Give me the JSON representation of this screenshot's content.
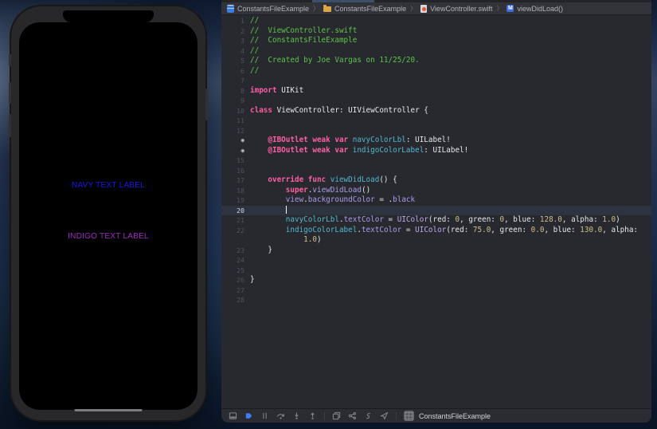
{
  "simulator": {
    "navy_label": "NAVY TEXT LABEL",
    "navy_color": "#1d16ee",
    "indigo_label": "INDIGO TEXT LABEL",
    "indigo_color": "#a428c8"
  },
  "jumpbar": {
    "separator": "〉",
    "project": "ConstantsFileExample",
    "group": "ConstantsFileExample",
    "file": "ViewController.swift",
    "method": "viewDidLoad()",
    "method_badge": "M"
  },
  "editor": {
    "colors": {
      "background": "#27292e",
      "current_line": "#2e3340",
      "comment": "#5dc34a",
      "keyword": "#fc5fa3",
      "project_symbol": "#54b8ce",
      "sdk_member": "#ab9bea",
      "sdk_class": "#c0a6f0",
      "number": "#d0bf8f",
      "plain": "#e8e8ea"
    },
    "outlet_marker": "◉",
    "lines": [
      {
        "num": "1",
        "segs": [
          [
            "cm",
            "//"
          ]
        ]
      },
      {
        "num": "2",
        "segs": [
          [
            "cm",
            "//  ViewController.swift"
          ]
        ]
      },
      {
        "num": "3",
        "segs": [
          [
            "cm",
            "//  ConstantsFileExample"
          ]
        ]
      },
      {
        "num": "4",
        "segs": [
          [
            "cm",
            "//"
          ]
        ]
      },
      {
        "num": "5",
        "segs": [
          [
            "cm",
            "//  Created by Joe Vargas on 11/25/20."
          ]
        ]
      },
      {
        "num": "6",
        "segs": [
          [
            "cm",
            "//"
          ]
        ]
      },
      {
        "num": "7",
        "segs": []
      },
      {
        "num": "8",
        "segs": [
          [
            "kw",
            "import"
          ],
          [
            "pl",
            " UIKit"
          ]
        ]
      },
      {
        "num": "9",
        "segs": []
      },
      {
        "num": "10",
        "segs": [
          [
            "kw",
            "class"
          ],
          [
            "pl",
            " ViewController: UIViewController {"
          ]
        ]
      },
      {
        "num": "11",
        "segs": []
      },
      {
        "num": "12",
        "segs": []
      },
      {
        "num": "13",
        "marker": true,
        "segs": [
          [
            "kw",
            "    @IBOutlet weak var"
          ],
          [
            "pr",
            " navyColorLbl"
          ],
          [
            "pl",
            ": UILabel!"
          ]
        ]
      },
      {
        "num": "14",
        "marker": true,
        "segs": [
          [
            "kw",
            "    @IBOutlet weak var"
          ],
          [
            "pr",
            " indigoColorLabel"
          ],
          [
            "pl",
            ": UILabel!"
          ]
        ]
      },
      {
        "num": "15",
        "segs": []
      },
      {
        "num": "16",
        "segs": []
      },
      {
        "num": "17",
        "segs": [
          [
            "pl",
            "    "
          ],
          [
            "kw",
            "override func"
          ],
          [
            "pr",
            " viewDidLoad"
          ],
          [
            "pl",
            "() {"
          ]
        ]
      },
      {
        "num": "18",
        "segs": [
          [
            "pl",
            "        "
          ],
          [
            "kw",
            "super"
          ],
          [
            "pl",
            "."
          ],
          [
            "sdk",
            "viewDidLoad"
          ],
          [
            "pl",
            "()"
          ]
        ]
      },
      {
        "num": "19",
        "segs": [
          [
            "pl",
            "        "
          ],
          [
            "sdk",
            "view"
          ],
          [
            "pl",
            "."
          ],
          [
            "sdk",
            "backgroundColor"
          ],
          [
            "pl",
            " = ."
          ],
          [
            "sdk",
            "black"
          ]
        ]
      },
      {
        "num": "20",
        "current": true,
        "cursor": true,
        "segs": [
          [
            "pl",
            "        "
          ]
        ]
      },
      {
        "num": "21",
        "segs": [
          [
            "pl",
            "        "
          ],
          [
            "pr",
            "navyColorLbl"
          ],
          [
            "pl",
            "."
          ],
          [
            "sdk",
            "textColor"
          ],
          [
            "pl",
            " = "
          ],
          [
            "cls",
            "UIColor"
          ],
          [
            "pl",
            "(red: "
          ],
          [
            "num",
            "0"
          ],
          [
            "pl",
            ", green: "
          ],
          [
            "num",
            "0"
          ],
          [
            "pl",
            ", blue: "
          ],
          [
            "num",
            "128.0"
          ],
          [
            "pl",
            ", alpha: "
          ],
          [
            "num",
            "1.0"
          ],
          [
            "pl",
            ")"
          ]
        ]
      },
      {
        "num": "22",
        "segs": [
          [
            "pl",
            "        "
          ],
          [
            "pr",
            "indigoColorLabel"
          ],
          [
            "pl",
            "."
          ],
          [
            "sdk",
            "textColor"
          ],
          [
            "pl",
            " = "
          ],
          [
            "cls",
            "UIColor"
          ],
          [
            "pl",
            "(red: "
          ],
          [
            "num",
            "75.0"
          ],
          [
            "pl",
            ", green: "
          ],
          [
            "num",
            "0.0"
          ],
          [
            "pl",
            ", blue: "
          ],
          [
            "num",
            "130.0"
          ],
          [
            "pl",
            ", alpha:"
          ]
        ]
      },
      {
        "num": "",
        "segs": [
          [
            "pl",
            "            "
          ],
          [
            "num",
            "1.0"
          ],
          [
            "pl",
            ")"
          ]
        ]
      },
      {
        "num": "23",
        "segs": [
          [
            "pl",
            "    }"
          ]
        ]
      },
      {
        "num": "24",
        "segs": []
      },
      {
        "num": "25",
        "segs": []
      },
      {
        "num": "26",
        "segs": [
          [
            "pl",
            "}"
          ]
        ]
      },
      {
        "num": "27",
        "segs": []
      },
      {
        "num": "28",
        "segs": []
      }
    ]
  },
  "debugbar": {
    "breakpoint_color": "#3f7cf6",
    "process_name": "ConstantsFileExample"
  }
}
